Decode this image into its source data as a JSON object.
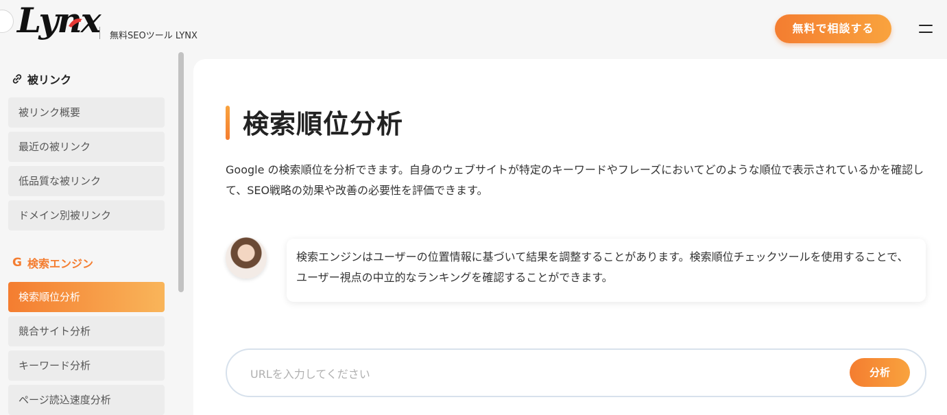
{
  "header": {
    "logo_text": "Lynx",
    "tagline": "無料SEOツール LYNX",
    "cta_label": "無料で相談する",
    "menu_icon": "hamburger-icon"
  },
  "sidebar": {
    "sections": [
      {
        "title": "被リンク",
        "icon": "link-icon",
        "items": [
          "被リンク概要",
          "最近の被リンク",
          "低品質な被リンク",
          "ドメイン別被リンク"
        ]
      },
      {
        "title": "検索エンジン",
        "icon": "google-icon",
        "items": [
          "検索順位分析",
          "競合サイト分析",
          "キーワード分析",
          "ページ読込速度分析"
        ],
        "active": "検索順位分析"
      }
    ]
  },
  "main": {
    "title": "検索順位分析",
    "description": "Google の検索順位を分析できます。自身のウェブサイトが特定のキーワードやフレーズにおいてどのような順位で表示されているかを確認して、SEO戦略の効果や改善の必要性を評価できます。",
    "tip": "検索エンジンはユーザーの位置情報に基づいて結果を調整することがあります。検索順位チェックツールを使用することで、ユーザー視点の中立的なランキングを確認することができます。",
    "search_placeholder": "URLを入力してください",
    "analyze_label": "分析"
  },
  "colors": {
    "accent": "#f47d30",
    "accent_light": "#f9a33e",
    "background": "#f6f6f6"
  }
}
